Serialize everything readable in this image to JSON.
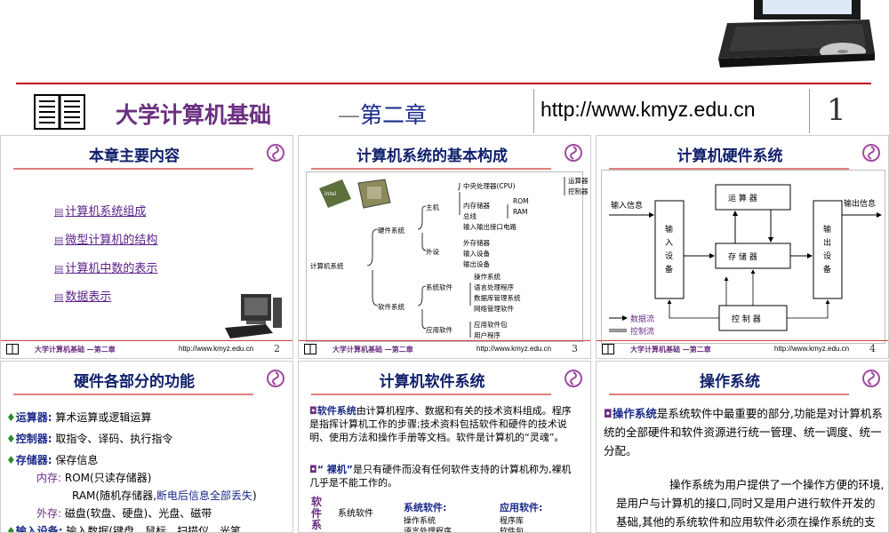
{
  "banner": {
    "title": "大学计算机基础",
    "dash": "—",
    "chapter": "第二章",
    "url": "http://www.kmyz.edu.cn",
    "page": "1"
  },
  "footer": {
    "title": "大学计算机基础 —第二章",
    "url": "http://www.kmyz.edu.cn"
  },
  "slides": {
    "s2": {
      "title": "本章主要内容",
      "items": [
        "计算机系统组成",
        "微型计算机的结构",
        "计算机中数的表示",
        "数据表示"
      ],
      "page": "2"
    },
    "s3": {
      "title": "计算机系统的基本构成",
      "page": "3",
      "root": "计算机系统",
      "hardware": "硬件系统",
      "software": "软件系统",
      "host": "主机",
      "peripheral": "外设",
      "cpu": "中央处理器(CPU)",
      "alu": "运算器",
      "cu": "控制器",
      "memory": "内存储器",
      "rom": "ROM",
      "ram": "RAM",
      "bus": "总线",
      "io": "输入输出接口电路",
      "ext": "外存储器",
      "inputdev": "输入设备",
      "outputdev": "输出设备",
      "syssw": "系统软件",
      "os": "操作系统",
      "lang": "语言处理程序",
      "dbms": "数据库管理系统",
      "net": "网络管理软件",
      "appsw": "应用软件",
      "apppkg": "应用软件包",
      "userprog": "用户程序"
    },
    "s4": {
      "title": "计算机硬件系统",
      "page": "4",
      "input_info": "输入信息",
      "input_dev": "输入设备",
      "alu": "运 算 器",
      "storage": "存 储 器",
      "output_dev": "输出设备",
      "output_info": "输出信息",
      "control": "控 制 器",
      "data_flow": "数据流",
      "control_flow": "控制流"
    },
    "s5": {
      "title": "硬件各部分的功能",
      "alu_label": "运算器:",
      "alu_text": "算术运算或逻辑运算",
      "ctrl_label": "控制器:",
      "ctrl_text": "取指令、译码、执行指令",
      "mem_label": "存储器:",
      "mem_text": "保存信息",
      "inner_label": "内存:",
      "rom_text": "ROM(只读存储器)",
      "ram_text": "RAM(随机存储器,",
      "ram_warn": "断电后信息全部丢失",
      "ram_end": ")",
      "outer_label": "外存:",
      "outer_text": "磁盘(软盘、硬盘)、光盘、磁带",
      "in_label": "输入设备:",
      "in_text": "输入数据(键盘、鼠标、扫描仪、光笔"
    },
    "s6": {
      "title": "计算机软件系统",
      "p1_term": "软件系统",
      "p1_text": "由计算机程序、数据和有关的技术资料组成。程序是指挥计算机工作的步骤;技术资料包括软件和硬件的技术说明、使用方法和操作手册等文档。软件是计算机的“灵魂”。",
      "p2_term": "“ 裸机”",
      "p2_text": "是只有硬件而没有任何软件支持的计算机称为,裸机几乎是不能工作的。",
      "side_label": "软件系",
      "col0": "系统软件",
      "col1": "系统软件:",
      "col1_item": "操作系统",
      "col1_item2": "语言处理程序",
      "col2": "应用软件:",
      "col2_item": "程序库",
      "col2_item2": "软件包"
    },
    "s7": {
      "title": "操作系统",
      "p1_term": "操作系统",
      "p1_text": "是系统软件中最重要的部分,功能是对计算机系统的全部硬件和软件资源进行统一管理、统一调度、统一分配。",
      "p2_text": "操作系统为用户提供了一个操作方便的环境,是用户与计算机的接口,同时又是用户进行软件开发的基础,其他的系统软件和应用软件必须在操作系统的支持下才能合理调度"
    }
  }
}
